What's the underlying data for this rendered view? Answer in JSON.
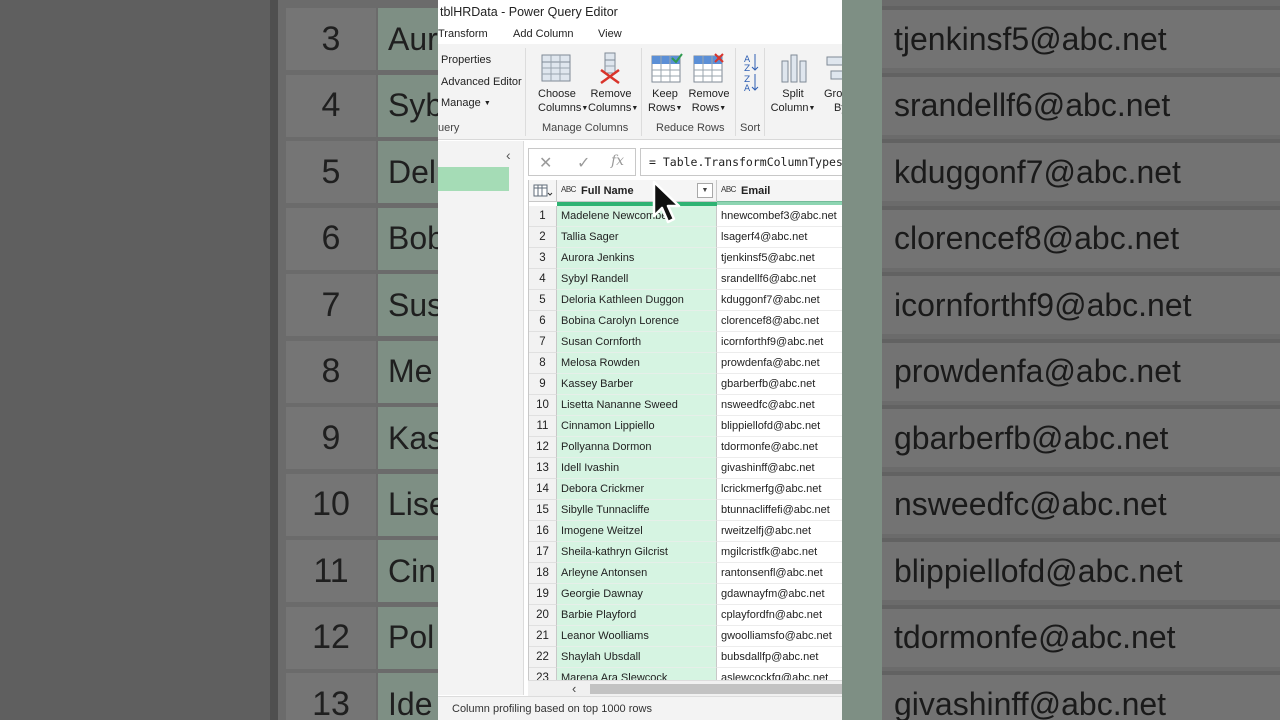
{
  "window": {
    "title": "tblHRData - Power Query Editor"
  },
  "menu": {
    "tabs": [
      "Transform",
      "Add Column",
      "View"
    ]
  },
  "ribbon": {
    "query_items": [
      "Properties",
      "Advanced Editor",
      "Manage"
    ],
    "query_group": "uery",
    "choose_columns": [
      "Choose",
      "Columns"
    ],
    "remove_columns": [
      "Remove",
      "Columns"
    ],
    "manage_group": "Manage Columns",
    "keep_rows": [
      "Keep",
      "Rows"
    ],
    "remove_rows": [
      "Remove",
      "Rows"
    ],
    "reduce_group": "Reduce Rows",
    "sort_group": "Sort",
    "split_column": [
      "Split",
      "Column"
    ],
    "group_by": [
      "Gro",
      "By"
    ]
  },
  "formula": {
    "cancel": "✕",
    "confirm": "✓",
    "fx": "fx",
    "text": "= Table.TransformColumnTypes("
  },
  "grid": {
    "columns": [
      {
        "type": "ABC",
        "name": "Full Name"
      },
      {
        "type": "ABC",
        "name": "Email"
      }
    ],
    "rows": [
      {
        "n": "1",
        "name": "Madelene Newcombe",
        "email": "hnewcombef3@abc.net"
      },
      {
        "n": "2",
        "name": "Tallia Sager",
        "email": "lsagerf4@abc.net"
      },
      {
        "n": "3",
        "name": "Aurora Jenkins",
        "email": "tjenkinsf5@abc.net"
      },
      {
        "n": "4",
        "name": "Sybyl Randell",
        "email": "srandellf6@abc.net"
      },
      {
        "n": "5",
        "name": "Deloria Kathleen Duggon",
        "email": "kduggonf7@abc.net"
      },
      {
        "n": "6",
        "name": "Bobina Carolyn Lorence",
        "email": "clorencef8@abc.net"
      },
      {
        "n": "7",
        "name": "Susan Cornforth",
        "email": "icornforthf9@abc.net"
      },
      {
        "n": "8",
        "name": "Melosa Rowden",
        "email": "prowdenfa@abc.net"
      },
      {
        "n": "9",
        "name": "Kassey Barber",
        "email": "gbarberfb@abc.net"
      },
      {
        "n": "10",
        "name": "Lisetta Nananne Sweed",
        "email": "nsweedfc@abc.net"
      },
      {
        "n": "11",
        "name": "Cinnamon Lippiello",
        "email": "blippiellofd@abc.net"
      },
      {
        "n": "12",
        "name": "Pollyanna Dormon",
        "email": "tdormonfe@abc.net"
      },
      {
        "n": "13",
        "name": "Idell Ivashin",
        "email": "givashinff@abc.net"
      },
      {
        "n": "14",
        "name": "Debora Crickmer",
        "email": "lcrickmerfg@abc.net"
      },
      {
        "n": "15",
        "name": "Sibylle Tunnacliffe",
        "email": "btunnacliffefi@abc.net"
      },
      {
        "n": "16",
        "name": "Imogene Weitzel",
        "email": "rweitzelfj@abc.net"
      },
      {
        "n": "17",
        "name": "Sheila-kathryn Gilcrist",
        "email": "mgilcristfk@abc.net"
      },
      {
        "n": "18",
        "name": "Arleyne Antonsen",
        "email": "rantonsenfl@abc.net"
      },
      {
        "n": "19",
        "name": "Georgie Dawnay",
        "email": "gdawnayfm@abc.net"
      },
      {
        "n": "20",
        "name": "Barbie Playford",
        "email": "cplayfordfn@abc.net"
      },
      {
        "n": "21",
        "name": "Leanor Woolliams",
        "email": "gwoolliamsfo@abc.net"
      },
      {
        "n": "22",
        "name": "Shaylah Ubsdall",
        "email": "bubsdallfp@abc.net"
      },
      {
        "n": "23",
        "name": "Marena Ara Slewcock",
        "email": "aslewcockfq@abc.net"
      },
      {
        "n": "24",
        "name": "",
        "email": ""
      }
    ]
  },
  "status": {
    "text": "Column profiling based on top 1000 rows"
  },
  "background": {
    "left_rows": [
      {
        "n": "3",
        "t": "Aur"
      },
      {
        "n": "4",
        "t": "Syb"
      },
      {
        "n": "5",
        "t": "Del"
      },
      {
        "n": "6",
        "t": "Bob"
      },
      {
        "n": "7",
        "t": "Sus"
      },
      {
        "n": "8",
        "t": "Me"
      },
      {
        "n": "9",
        "t": "Kas"
      },
      {
        "n": "10",
        "t": "Lise"
      },
      {
        "n": "11",
        "t": "Cin"
      },
      {
        "n": "12",
        "t": "Pol"
      },
      {
        "n": "13",
        "t": "Ide"
      }
    ],
    "right_rows": [
      "tjenkinsf5@abc.net",
      "srandellf6@abc.net",
      "kduggonf7@abc.net",
      "clorencef8@abc.net",
      "icornforthf9@abc.net",
      "prowdenfa@abc.net",
      "gbarberfb@abc.net",
      "nsweedfc@abc.net",
      "blippiellofd@abc.net",
      "tdormonfe@abc.net",
      "givashinff@abc.net"
    ]
  }
}
